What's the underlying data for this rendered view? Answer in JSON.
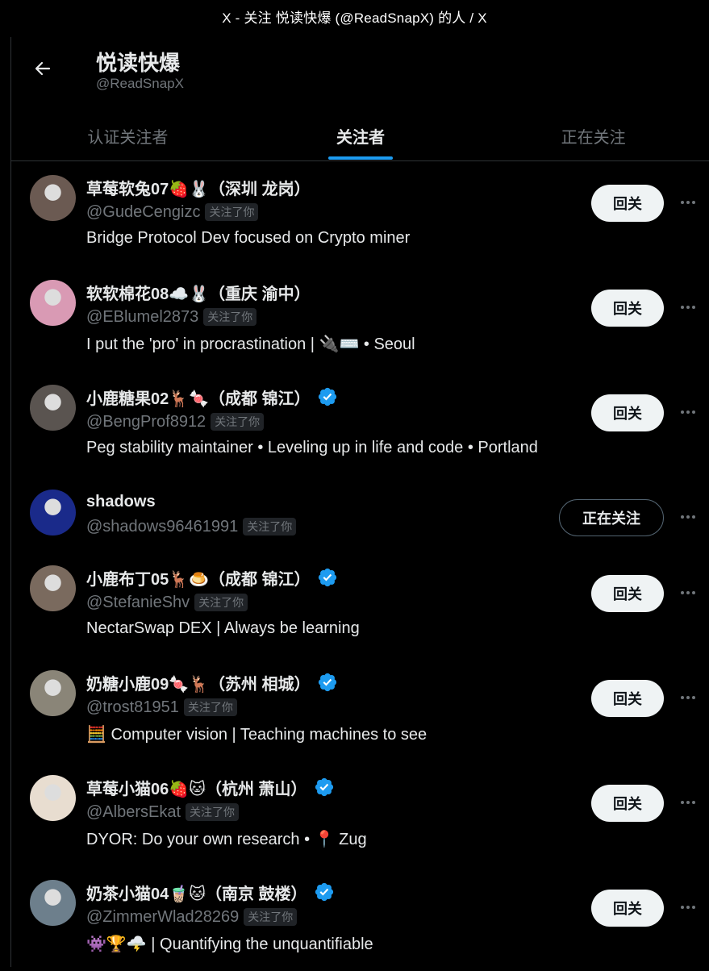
{
  "window": {
    "title": "X - 关注 悦读快爆 (@ReadSnapX) 的人 / X"
  },
  "profile": {
    "name": "悦读快爆",
    "handle": "@ReadSnapX"
  },
  "tabs": [
    {
      "label": "认证关注者",
      "active": false
    },
    {
      "label": "关注者",
      "active": true
    },
    {
      "label": "正在关注",
      "active": false
    }
  ],
  "labels": {
    "follows_you": "关注了你"
  },
  "users": [
    {
      "name": "草莓软兔07🍓🐰（深圳 龙岗）",
      "handle": "@GudeCengizc",
      "verified": false,
      "bio": "Bridge Protocol Dev focused on Crypto miner",
      "button": "回关",
      "following": false,
      "avatar_color": "#6b5a52"
    },
    {
      "name": "软软棉花08☁️🐰（重庆 渝中）",
      "handle": "@EBlumel2873",
      "verified": false,
      "bio": "I put the 'pro' in procrastination | 🔌⌨️ • Seoul",
      "button": "回关",
      "following": false,
      "avatar_color": "#d99ab4"
    },
    {
      "name": "小鹿糖果02🦌🍬（成都 锦江）",
      "handle": "@BengProf8912",
      "verified": true,
      "bio": "Peg stability maintainer • Leveling up in life and code • Portland",
      "button": "回关",
      "following": false,
      "avatar_color": "#5a5450"
    },
    {
      "name": "shadows",
      "handle": "@shadows96461991",
      "verified": false,
      "bio": "",
      "button": "正在关注",
      "following": true,
      "avatar_color": "#1a2a8a"
    },
    {
      "name": "小鹿布丁05🦌🍮（成都 锦江）",
      "handle": "@StefanieShv",
      "verified": true,
      "bio": "NectarSwap DEX | Always be learning",
      "button": "回关",
      "following": false,
      "avatar_color": "#7a6a5e"
    },
    {
      "name": "奶糖小鹿09🍬🦌（苏州 相城）",
      "handle": "@trost81951",
      "verified": true,
      "bio": "🧮 Computer vision | Teaching machines to see",
      "button": "回关",
      "following": false,
      "avatar_color": "#8a8578"
    },
    {
      "name": "草莓小猫06🍓🐱（杭州 萧山）",
      "handle": "@AlbersEkat",
      "verified": true,
      "bio": "DYOR: Do your own research • 📍 Zug",
      "button": "回关",
      "following": false,
      "avatar_color": "#e8ddd0"
    },
    {
      "name": "奶茶小猫04🧋🐱（南京 鼓楼）",
      "handle": "@ZimmerWlad28269",
      "verified": true,
      "bio": "👾🏆🌩️ | Quantifying the unquantifiable",
      "button": "回关",
      "following": false,
      "avatar_color": "#6d7f8c"
    }
  ]
}
